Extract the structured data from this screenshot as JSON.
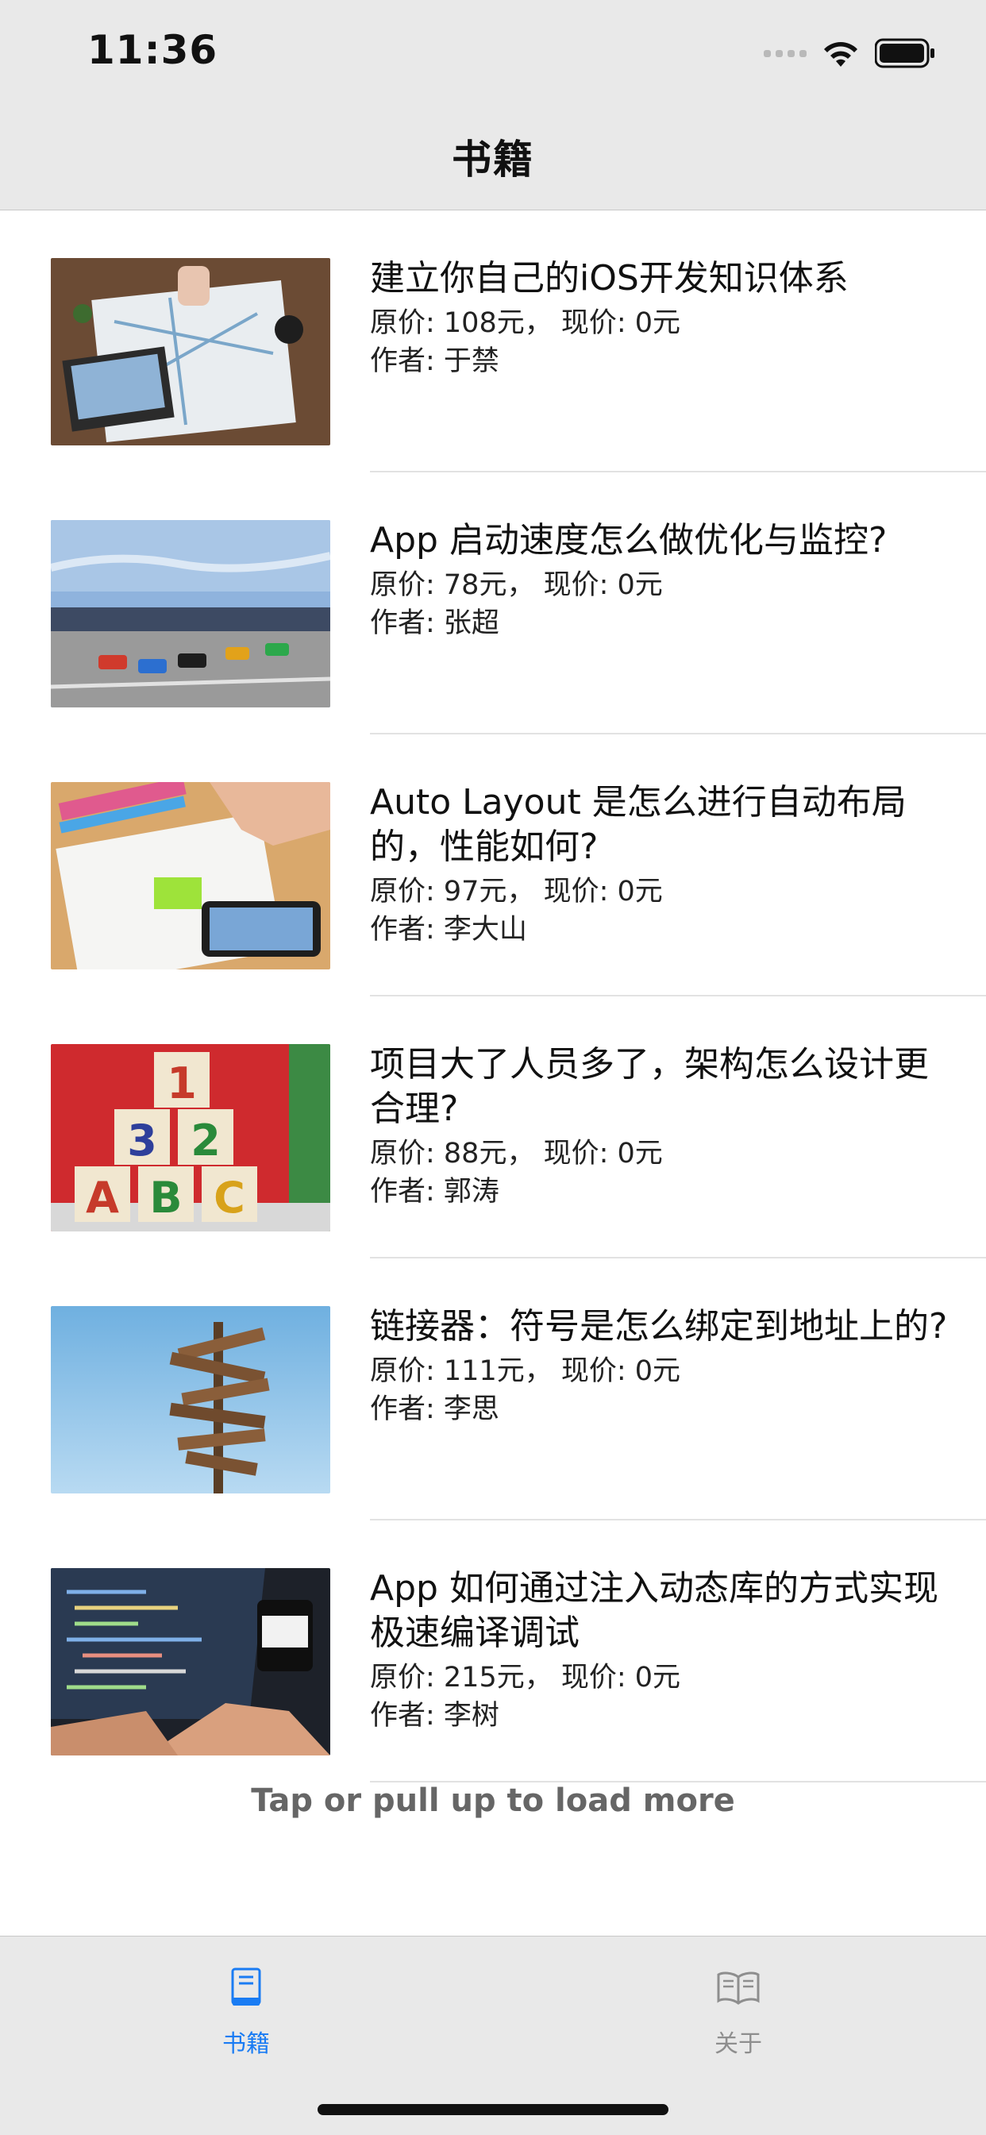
{
  "status_bar": {
    "time": "11:36"
  },
  "nav": {
    "title": "书籍"
  },
  "books": [
    {
      "title": "建立你自己的iOS开发知识体系",
      "price": "原价: 108元， 现价: 0元",
      "author": "作者: 于禁",
      "image": "travel-map-photo"
    },
    {
      "title": "App 启动速度怎么做优化与监控?",
      "price": "原价: 78元， 现价: 0元",
      "author": "作者: 张超",
      "image": "race-cars-photo"
    },
    {
      "title": "Auto Layout 是怎么进行自动布局的，性能如何?",
      "price": "原价: 97元， 现价: 0元",
      "author": "作者: 李大山",
      "image": "sketching-phone-photo"
    },
    {
      "title": "项目大了人员多了，架构怎么设计更合理?",
      "price": "原价: 88元， 现价: 0元",
      "author": "作者: 郭涛",
      "image": "toy-blocks-photo"
    },
    {
      "title": "链接器：符号是怎么绑定到地址上的?",
      "price": "原价: 111元， 现价: 0元",
      "author": "作者: 李思",
      "image": "signpost-photo"
    },
    {
      "title": "App 如何通过注入动态库的方式实现极速编译调试",
      "price": "原价: 215元， 现价: 0元",
      "author": "作者: 李树",
      "image": "laptop-code-photo"
    }
  ],
  "load_more": "Tap or pull up to load more",
  "tabs": [
    {
      "label": "书籍",
      "icon": "book-icon",
      "active": true
    },
    {
      "label": "关于",
      "icon": "open-book-icon",
      "active": false
    }
  ],
  "colors": {
    "accent": "#1a7cf3",
    "inactive": "#8e8e8e",
    "bar_bg": "#e9e9e9"
  }
}
